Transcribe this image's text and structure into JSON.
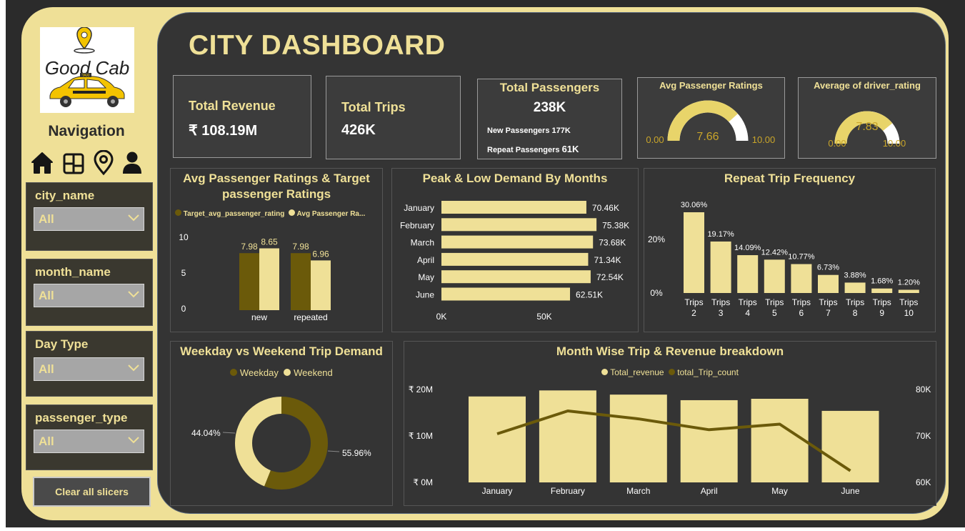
{
  "brand": {
    "logo_text": "Good Cab",
    "taxi_label": "TAXI"
  },
  "navigation": {
    "title": "Navigation",
    "icons": [
      "home-icon",
      "dashboard-grid-icon",
      "location-pin-icon",
      "user-icon"
    ]
  },
  "slicers": [
    {
      "label": "city_name",
      "value": "All"
    },
    {
      "label": "month_name",
      "value": "All"
    },
    {
      "label": "Day Type",
      "value": "All"
    },
    {
      "label": "passenger_type",
      "value": "All"
    }
  ],
  "clear_button": "Clear all slicers",
  "dashboard_title": "CITY DASHBOARD",
  "kpis": {
    "total_revenue": {
      "label": "Total Revenue",
      "value": "₹ 108.19M"
    },
    "total_trips": {
      "label": "Total Trips",
      "value": "426K"
    },
    "total_passengers": {
      "label": "Total Passengers",
      "value": "238K",
      "new_label": "New Passengers",
      "new_value": "177K",
      "repeat_label": "Repeat Passengers",
      "repeat_value": "61K"
    }
  },
  "gauges": [
    {
      "title": "Avg Passenger Ratings",
      "value": 7.66,
      "value_label": "7.66",
      "min": "0.00",
      "max": "10.00"
    },
    {
      "title": "Average of driver_rating",
      "value": 7.83,
      "value_label": "7.83",
      "min": "0.00",
      "max": "10.00"
    }
  ],
  "colors": {
    "accent": "#efe097",
    "dark_series": "#6b5a0a",
    "background": "#343434",
    "frame": "#2b2b2b"
  },
  "chart_data": [
    {
      "id": "ratings",
      "type": "bar",
      "title": "Avg Passenger Ratings & Target passenger Ratings",
      "categories": [
        "new",
        "repeated"
      ],
      "series": [
        {
          "name": "Target_avg_passenger_rating",
          "values": [
            7.98,
            7.98
          ],
          "labels": [
            "7.98",
            "7.98"
          ],
          "color": "#6b5a0a"
        },
        {
          "name": "Avg Passenger Ra...",
          "values": [
            8.65,
            6.96
          ],
          "labels": [
            "8.65",
            "6.96"
          ],
          "color": "#efe097"
        }
      ],
      "yticks": [
        "10",
        "5",
        "0"
      ],
      "ylim": [
        0,
        10
      ]
    },
    {
      "id": "months",
      "type": "bar",
      "orientation": "horizontal",
      "title": "Peak & Low Demand By Months",
      "categories": [
        "January",
        "February",
        "March",
        "April",
        "May",
        "June"
      ],
      "values": [
        70.46,
        75.38,
        73.68,
        71.34,
        72.54,
        62.51
      ],
      "labels": [
        "70.46K",
        "75.38K",
        "73.68K",
        "71.34K",
        "72.54K",
        "62.51K"
      ],
      "xticks": [
        "0K",
        "50K"
      ],
      "unit": "K"
    },
    {
      "id": "repeat",
      "type": "bar",
      "title": "Repeat Trip Frequency",
      "categories": [
        [
          "Trips",
          "2"
        ],
        [
          "Trips",
          "3"
        ],
        [
          "Trips",
          "4"
        ],
        [
          "Trips",
          "5"
        ],
        [
          "Trips",
          "6"
        ],
        [
          "Trips",
          "7"
        ],
        [
          "Trips",
          "8"
        ],
        [
          "Trips",
          "9"
        ],
        [
          "Trips",
          "10"
        ]
      ],
      "values": [
        30.06,
        19.17,
        14.09,
        12.42,
        10.77,
        6.73,
        3.88,
        1.68,
        1.2
      ],
      "labels": [
        "30.06%",
        "19.17%",
        "14.09%",
        "12.42%",
        "10.77%",
        "6.73%",
        "3.88%",
        "1.68%",
        "1.20%"
      ],
      "yticks": [
        "20%",
        "0%"
      ]
    },
    {
      "id": "daytype",
      "type": "pie",
      "title": "Weekday vs Weekend Trip Demand",
      "legend": [
        "Weekday",
        "Weekend"
      ],
      "slices": [
        {
          "name": "Weekday",
          "value": 55.96,
          "label": "55.96%",
          "color": "#6b5a0a"
        },
        {
          "name": "Weekend",
          "value": 44.04,
          "label": "44.04%",
          "color": "#efe097"
        }
      ]
    },
    {
      "id": "monthwise",
      "type": "bar",
      "title": "Month Wise Trip & Revenue breakdown",
      "legend": [
        "Total_revenue",
        "total_Trip_count"
      ],
      "categories": [
        "January",
        "February",
        "March",
        "April",
        "May",
        "June"
      ],
      "series": [
        {
          "name": "Total_revenue",
          "type": "bar",
          "values": [
            18.5,
            19.8,
            18.9,
            17.7,
            18.0,
            15.4
          ],
          "unit": "M"
        },
        {
          "name": "total_Trip_count",
          "type": "line",
          "values": [
            70.46,
            75.38,
            73.68,
            71.34,
            72.54,
            62.51
          ],
          "unit": "K"
        }
      ],
      "y_left_ticks": [
        "₹ 20M",
        "₹ 10M",
        "₹ 0M"
      ],
      "y_right_ticks": [
        "80K",
        "70K",
        "60K"
      ],
      "ylim_left": [
        0,
        20
      ],
      "ylim_right": [
        60,
        80
      ]
    }
  ]
}
